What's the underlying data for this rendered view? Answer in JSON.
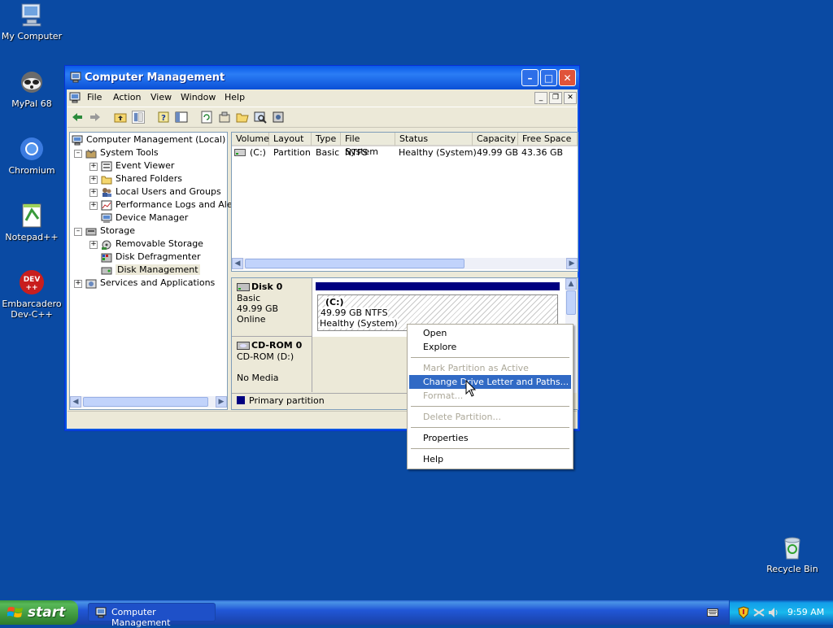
{
  "desktop": {
    "icons": [
      {
        "label": "My Computer"
      },
      {
        "label": "MyPal 68"
      },
      {
        "label": "Chromium"
      },
      {
        "label": "Notepad++"
      },
      {
        "label": "Embarcadero Dev-C++"
      },
      {
        "label": "Recycle Bin"
      }
    ]
  },
  "window": {
    "title": "Computer Management",
    "menu": [
      "File",
      "Action",
      "View",
      "Window",
      "Help"
    ],
    "tree": [
      {
        "label": "Computer Management (Local)",
        "icon": "computer-icon"
      },
      {
        "label": "System Tools",
        "icon": "tools-icon"
      },
      {
        "label": "Event Viewer",
        "icon": "event-viewer-icon"
      },
      {
        "label": "Shared Folders",
        "icon": "folder-icon"
      },
      {
        "label": "Local Users and Groups",
        "icon": "users-icon"
      },
      {
        "label": "Performance Logs and Alerts",
        "icon": "performance-icon"
      },
      {
        "label": "Device Manager",
        "icon": "device-manager-icon"
      },
      {
        "label": "Storage",
        "icon": "storage-icon"
      },
      {
        "label": "Removable Storage",
        "icon": "removable-storage-icon"
      },
      {
        "label": "Disk Defragmenter",
        "icon": "defragmenter-icon"
      },
      {
        "label": "Disk Management",
        "icon": "disk-management-icon"
      },
      {
        "label": "Services and Applications",
        "icon": "services-icon"
      }
    ],
    "volumes": {
      "columns": [
        "Volume",
        "Layout",
        "Type",
        "File System",
        "Status",
        "Capacity",
        "Free Space"
      ],
      "rows": [
        {
          "volume": "(C:)",
          "layout": "Partition",
          "type": "Basic",
          "fs": "NTFS",
          "status": "Healthy (System)",
          "capacity": "49.99 GB",
          "free": "43.36 GB"
        }
      ]
    },
    "disks": [
      {
        "name": "Disk 0",
        "type": "Basic",
        "size": "49.99 GB",
        "state": "Online",
        "partition": {
          "label": "(C:)",
          "size": "49.99 GB NTFS",
          "status": "Healthy (System)"
        }
      },
      {
        "name": "CD-ROM 0",
        "type": "CD-ROM (D:)",
        "state": "No Media"
      }
    ],
    "legend": "Primary partition"
  },
  "context_menu": {
    "items": [
      {
        "label": "Open",
        "enabled": true
      },
      {
        "label": "Explore",
        "enabled": true
      },
      {
        "label": "Mark Partition as Active",
        "enabled": false
      },
      {
        "label": "Change Drive Letter and Paths...",
        "enabled": true,
        "highlighted": true
      },
      {
        "label": "Format...",
        "enabled": false
      },
      {
        "label": "Delete Partition...",
        "enabled": false
      },
      {
        "label": "Properties",
        "enabled": true
      },
      {
        "label": "Help",
        "enabled": true
      }
    ]
  },
  "taskbar": {
    "start_label": "start",
    "task": "Computer Management",
    "clock": "9:59 AM"
  },
  "colors": {
    "desktop": "#0a4aa3",
    "highlight": "#316ac5",
    "primary_partition": "#000080"
  }
}
